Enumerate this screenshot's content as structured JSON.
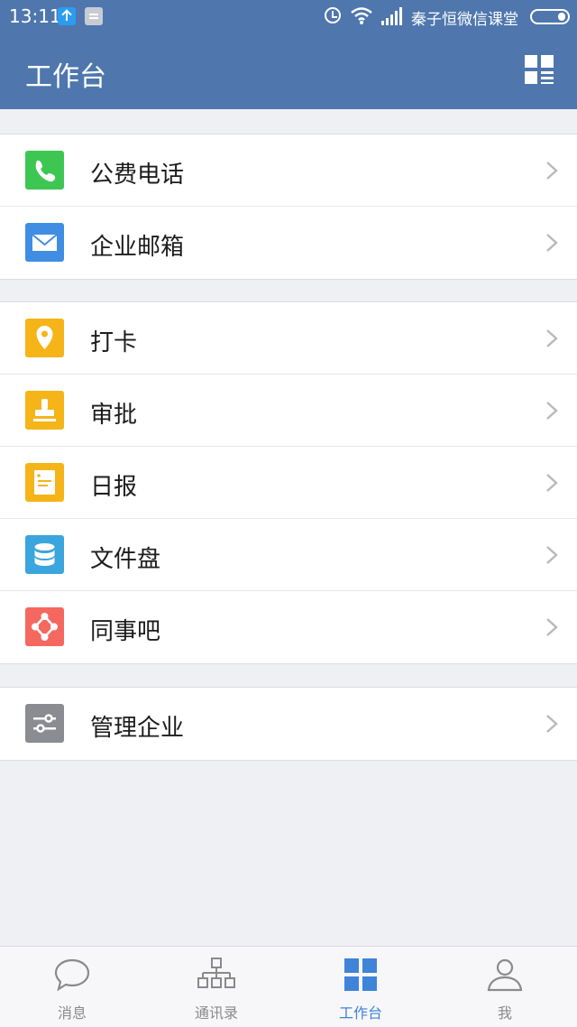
{
  "status_bar": {
    "time": "13:11",
    "carrier": "秦子恒微信课堂"
  },
  "header": {
    "title": "工作台"
  },
  "groups": [
    {
      "items": [
        {
          "label": "公费电话",
          "icon": "phone-icon",
          "color": "#3ec653"
        },
        {
          "label": "企业邮箱",
          "icon": "mail-icon",
          "color": "#3f8ee3"
        }
      ]
    },
    {
      "items": [
        {
          "label": "打卡",
          "icon": "location-pin-icon",
          "color": "#f5b418"
        },
        {
          "label": "审批",
          "icon": "stamp-icon",
          "color": "#f5b418"
        },
        {
          "label": "日报",
          "icon": "report-icon",
          "color": "#f5b418"
        },
        {
          "label": "文件盘",
          "icon": "database-icon",
          "color": "#3ba5dd"
        },
        {
          "label": "同事吧",
          "icon": "colleague-icon",
          "color": "#f4685f"
        }
      ]
    },
    {
      "items": [
        {
          "label": "管理企业",
          "icon": "settings-sliders-icon",
          "color": "#8a8c91"
        }
      ]
    }
  ],
  "tabbar": {
    "tabs": [
      {
        "label": "消息",
        "icon": "chat-bubble-icon",
        "active": false
      },
      {
        "label": "通讯录",
        "icon": "org-chart-icon",
        "active": false
      },
      {
        "label": "工作台",
        "icon": "grid-icon",
        "active": true
      },
      {
        "label": "我",
        "icon": "person-icon",
        "active": false
      }
    ]
  },
  "colors": {
    "header_bg": "#4f77ad",
    "page_bg": "#eff0f4",
    "tab_active": "#3f84d8",
    "tab_inactive": "#8a8a8a"
  }
}
